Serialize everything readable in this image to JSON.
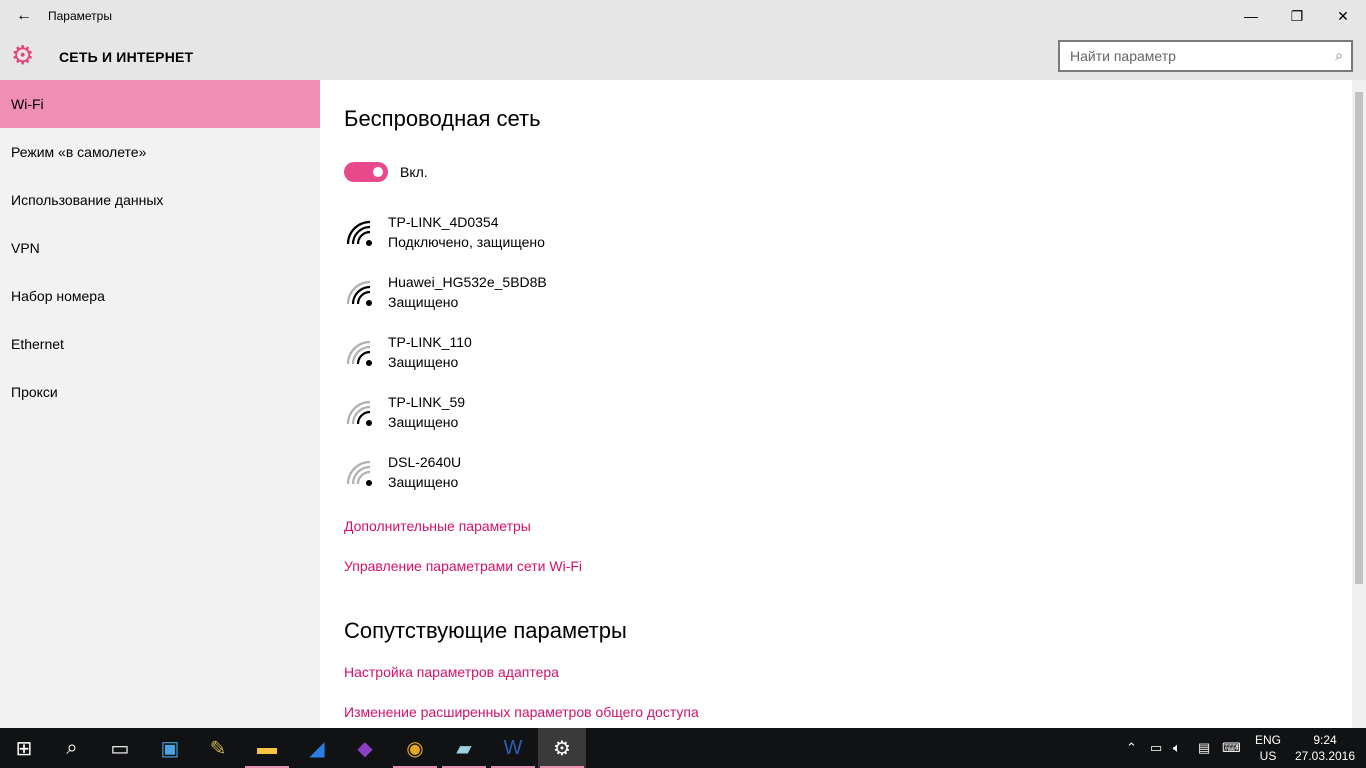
{
  "window": {
    "title": "Параметры",
    "back": "←",
    "minimize": "—",
    "restore": "❐",
    "close": "✕"
  },
  "header": {
    "title": "СЕТЬ И ИНТЕРНЕТ",
    "search_placeholder": "Найти параметр"
  },
  "sidebar": {
    "items": [
      {
        "label": "Wi-Fi"
      },
      {
        "label": "Режим «в самолете»"
      },
      {
        "label": "Использование данных"
      },
      {
        "label": "VPN"
      },
      {
        "label": "Набор номера"
      },
      {
        "label": "Ethernet"
      },
      {
        "label": "Прокси"
      }
    ]
  },
  "main": {
    "title": "Беспроводная сеть",
    "toggle_label": "Вкл.",
    "toggle_on": true,
    "networks": [
      {
        "name": "TP-LINK_4D0354",
        "status": "Подключено, защищено",
        "signal": 4
      },
      {
        "name": "Huawei_HG532e_5BD8B",
        "status": "Защищено",
        "signal": 3
      },
      {
        "name": "TP-LINK_110",
        "status": "Защищено",
        "signal": 2
      },
      {
        "name": "TP-LINK_59",
        "status": "Защищено",
        "signal": 2
      },
      {
        "name": "DSL-2640U",
        "status": "Защищено",
        "signal": 1
      }
    ],
    "links": [
      "Дополнительные параметры",
      "Управление параметрами сети Wi-Fi"
    ],
    "related_title": "Сопутствующие параметры",
    "related_links": [
      "Настройка параметров адаптера",
      "Изменение расширенных параметров общего доступа"
    ]
  },
  "taskbar": {
    "lang1": "ENG",
    "lang2": "US",
    "time": "9:24",
    "date": "27.03.2016"
  },
  "colors": {
    "accent": "#e8498a",
    "link": "#d3126a",
    "active_nav": "#ef8fb4"
  }
}
